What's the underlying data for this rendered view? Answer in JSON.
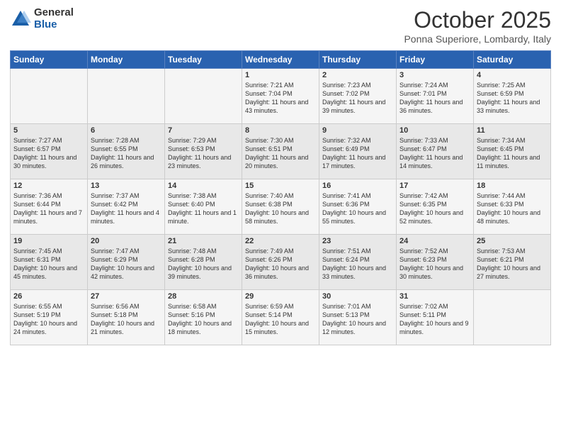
{
  "logo": {
    "general": "General",
    "blue": "Blue"
  },
  "title": "October 2025",
  "location": "Ponna Superiore, Lombardy, Italy",
  "days_of_week": [
    "Sunday",
    "Monday",
    "Tuesday",
    "Wednesday",
    "Thursday",
    "Friday",
    "Saturday"
  ],
  "weeks": [
    [
      {
        "day": "",
        "content": ""
      },
      {
        "day": "",
        "content": ""
      },
      {
        "day": "",
        "content": ""
      },
      {
        "day": "1",
        "content": "Sunrise: 7:21 AM\nSunset: 7:04 PM\nDaylight: 11 hours and 43 minutes."
      },
      {
        "day": "2",
        "content": "Sunrise: 7:23 AM\nSunset: 7:02 PM\nDaylight: 11 hours and 39 minutes."
      },
      {
        "day": "3",
        "content": "Sunrise: 7:24 AM\nSunset: 7:01 PM\nDaylight: 11 hours and 36 minutes."
      },
      {
        "day": "4",
        "content": "Sunrise: 7:25 AM\nSunset: 6:59 PM\nDaylight: 11 hours and 33 minutes."
      }
    ],
    [
      {
        "day": "5",
        "content": "Sunrise: 7:27 AM\nSunset: 6:57 PM\nDaylight: 11 hours and 30 minutes."
      },
      {
        "day": "6",
        "content": "Sunrise: 7:28 AM\nSunset: 6:55 PM\nDaylight: 11 hours and 26 minutes."
      },
      {
        "day": "7",
        "content": "Sunrise: 7:29 AM\nSunset: 6:53 PM\nDaylight: 11 hours and 23 minutes."
      },
      {
        "day": "8",
        "content": "Sunrise: 7:30 AM\nSunset: 6:51 PM\nDaylight: 11 hours and 20 minutes."
      },
      {
        "day": "9",
        "content": "Sunrise: 7:32 AM\nSunset: 6:49 PM\nDaylight: 11 hours and 17 minutes."
      },
      {
        "day": "10",
        "content": "Sunrise: 7:33 AM\nSunset: 6:47 PM\nDaylight: 11 hours and 14 minutes."
      },
      {
        "day": "11",
        "content": "Sunrise: 7:34 AM\nSunset: 6:45 PM\nDaylight: 11 hours and 11 minutes."
      }
    ],
    [
      {
        "day": "12",
        "content": "Sunrise: 7:36 AM\nSunset: 6:44 PM\nDaylight: 11 hours and 7 minutes."
      },
      {
        "day": "13",
        "content": "Sunrise: 7:37 AM\nSunset: 6:42 PM\nDaylight: 11 hours and 4 minutes."
      },
      {
        "day": "14",
        "content": "Sunrise: 7:38 AM\nSunset: 6:40 PM\nDaylight: 11 hours and 1 minute."
      },
      {
        "day": "15",
        "content": "Sunrise: 7:40 AM\nSunset: 6:38 PM\nDaylight: 10 hours and 58 minutes."
      },
      {
        "day": "16",
        "content": "Sunrise: 7:41 AM\nSunset: 6:36 PM\nDaylight: 10 hours and 55 minutes."
      },
      {
        "day": "17",
        "content": "Sunrise: 7:42 AM\nSunset: 6:35 PM\nDaylight: 10 hours and 52 minutes."
      },
      {
        "day": "18",
        "content": "Sunrise: 7:44 AM\nSunset: 6:33 PM\nDaylight: 10 hours and 48 minutes."
      }
    ],
    [
      {
        "day": "19",
        "content": "Sunrise: 7:45 AM\nSunset: 6:31 PM\nDaylight: 10 hours and 45 minutes."
      },
      {
        "day": "20",
        "content": "Sunrise: 7:47 AM\nSunset: 6:29 PM\nDaylight: 10 hours and 42 minutes."
      },
      {
        "day": "21",
        "content": "Sunrise: 7:48 AM\nSunset: 6:28 PM\nDaylight: 10 hours and 39 minutes."
      },
      {
        "day": "22",
        "content": "Sunrise: 7:49 AM\nSunset: 6:26 PM\nDaylight: 10 hours and 36 minutes."
      },
      {
        "day": "23",
        "content": "Sunrise: 7:51 AM\nSunset: 6:24 PM\nDaylight: 10 hours and 33 minutes."
      },
      {
        "day": "24",
        "content": "Sunrise: 7:52 AM\nSunset: 6:23 PM\nDaylight: 10 hours and 30 minutes."
      },
      {
        "day": "25",
        "content": "Sunrise: 7:53 AM\nSunset: 6:21 PM\nDaylight: 10 hours and 27 minutes."
      }
    ],
    [
      {
        "day": "26",
        "content": "Sunrise: 6:55 AM\nSunset: 5:19 PM\nDaylight: 10 hours and 24 minutes."
      },
      {
        "day": "27",
        "content": "Sunrise: 6:56 AM\nSunset: 5:18 PM\nDaylight: 10 hours and 21 minutes."
      },
      {
        "day": "28",
        "content": "Sunrise: 6:58 AM\nSunset: 5:16 PM\nDaylight: 10 hours and 18 minutes."
      },
      {
        "day": "29",
        "content": "Sunrise: 6:59 AM\nSunset: 5:14 PM\nDaylight: 10 hours and 15 minutes."
      },
      {
        "day": "30",
        "content": "Sunrise: 7:01 AM\nSunset: 5:13 PM\nDaylight: 10 hours and 12 minutes."
      },
      {
        "day": "31",
        "content": "Sunrise: 7:02 AM\nSunset: 5:11 PM\nDaylight: 10 hours and 9 minutes."
      },
      {
        "day": "",
        "content": ""
      }
    ]
  ]
}
